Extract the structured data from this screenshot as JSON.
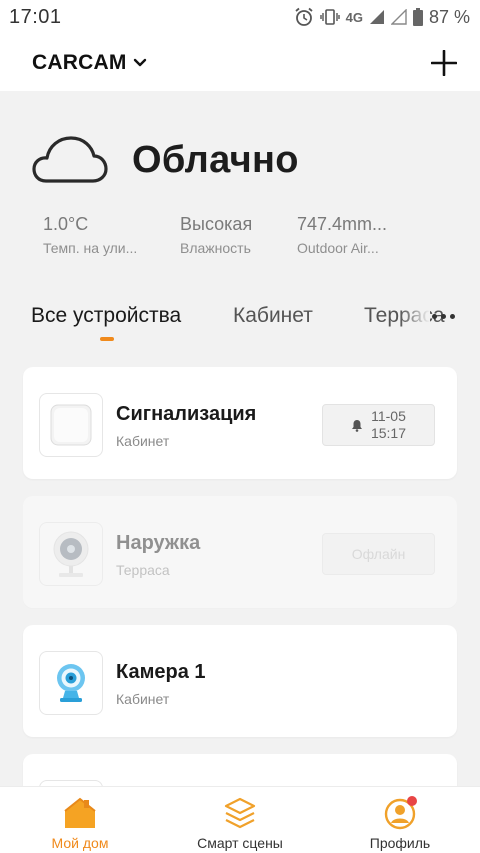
{
  "status_bar": {
    "time": "17:01",
    "network": "4G",
    "battery": "87 %"
  },
  "header": {
    "home_name": "CARCAM"
  },
  "weather": {
    "condition": "Облачно",
    "stats": [
      {
        "value": "1.0°C",
        "label": "Темп. на ули..."
      },
      {
        "value": "Высокая",
        "label": "Влажность"
      },
      {
        "value": "747.4mm...",
        "label": "Outdoor Air..."
      }
    ]
  },
  "tabs": [
    {
      "label": "Все устройства",
      "active": true
    },
    {
      "label": "Кабинет",
      "active": false
    },
    {
      "label": "Терраса",
      "active": false
    }
  ],
  "devices": [
    {
      "name": "Сигнализация",
      "room": "Кабинет",
      "status_line1": "11-05",
      "status_line2": "15:17",
      "icon": "alarm-hub-icon",
      "online": true
    },
    {
      "name": "Наружка",
      "room": "Терраса",
      "status": "Офлайн",
      "icon": "outdoor-camera-icon",
      "online": false
    },
    {
      "name": "Камера 1",
      "room": "Кабинет",
      "icon": "indoor-camera-icon",
      "online": true
    }
  ],
  "bottom_nav": [
    {
      "label": "Мой дом",
      "icon": "home-icon",
      "active": true
    },
    {
      "label": "Смарт сцены",
      "icon": "scenes-icon",
      "active": false
    },
    {
      "label": "Профиль",
      "icon": "profile-icon",
      "active": false
    }
  ],
  "colors": {
    "accent": "#f08a1c",
    "background": "#f2f2f2",
    "notification_dot": "#e84545"
  }
}
